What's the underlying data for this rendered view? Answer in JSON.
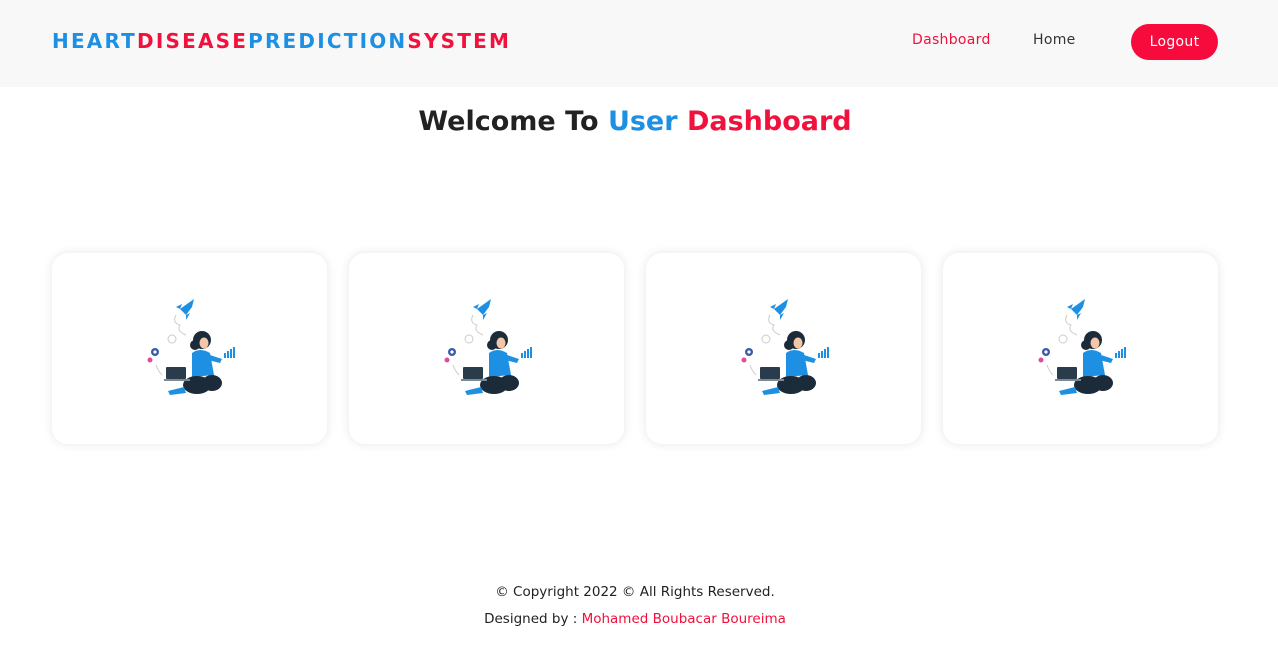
{
  "brand": {
    "part1": "HEART",
    "part2": "DISEASE",
    "part3": "PREDICTION",
    "part4": "SYSTEM"
  },
  "nav": {
    "dashboard": "Dashboard",
    "home": "Home",
    "logout": "Logout"
  },
  "title": {
    "prefix": "Welcome To ",
    "user": "User",
    "dashboard": " Dashboard"
  },
  "cards": [
    {
      "illustration": "person-with-laptop-rocket-illustration"
    },
    {
      "illustration": "person-with-laptop-rocket-illustration"
    },
    {
      "illustration": "person-with-laptop-rocket-illustration"
    },
    {
      "illustration": "person-with-laptop-rocket-illustration"
    }
  ],
  "footer": {
    "copyright": "© Copyright 2022 © All Rights Reserved.",
    "designed_by": "Designed by : ",
    "designer": "Mohamed Boubacar Boureima"
  },
  "colors": {
    "blue": "#1e90e3",
    "red": "#f0113d",
    "logout_bg": "#f70a3c",
    "navbar_bg": "#f8f8f8"
  }
}
